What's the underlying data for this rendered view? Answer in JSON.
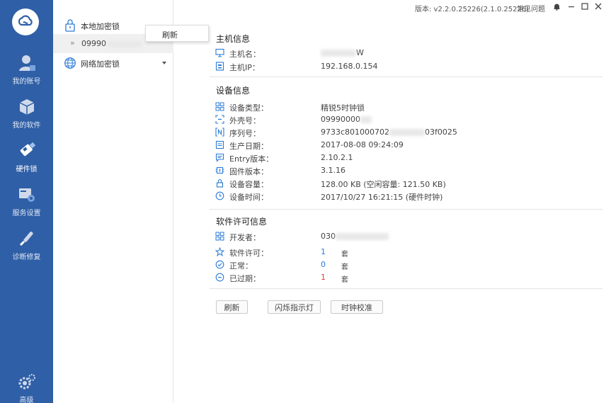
{
  "nav": {
    "items": [
      {
        "label": "我的账号",
        "icon": "user-icon"
      },
      {
        "label": "我的软件",
        "icon": "cube-icon"
      },
      {
        "label": "硬件锁",
        "icon": "usb-key-icon"
      },
      {
        "label": "服务设置",
        "icon": "settings-panel-icon"
      },
      {
        "label": "诊断修复",
        "icon": "repair-icon"
      },
      {
        "label": "高级",
        "icon": "gears-icon"
      }
    ],
    "active_index": 2
  },
  "tree": {
    "local_label": "本地加密锁",
    "local_child": "09990",
    "network_label": "网络加密锁"
  },
  "context_menu": {
    "refresh": "刷新"
  },
  "titlebar": {
    "version": "版本: v2.2.0.25226(2.1.0.25226)",
    "faq": "常见问题"
  },
  "host": {
    "title": "主机信息",
    "name_label": "主机名：",
    "name_value_suffix": "W",
    "ip_label": "主机IP：",
    "ip_value": "192.168.0.154"
  },
  "device": {
    "title": "设备信息",
    "rows": [
      {
        "label": "设备类型：",
        "value": "精锐5时钟锁",
        "icon": "grid-icon"
      },
      {
        "label": "外壳号：",
        "value": "09990000",
        "icon": "scan-icon"
      },
      {
        "label": "序列号：",
        "value": "9733c801000702",
        "value_suffix": "03f0025",
        "icon": "serial-icon"
      },
      {
        "label": "生产日期：",
        "value": "2017-08-08 09:24:09",
        "icon": "calendar-icon"
      },
      {
        "label": "Entry版本：",
        "value": "2.10.2.1",
        "icon": "chat-icon"
      },
      {
        "label": "固件版本：",
        "value": "3.1.16",
        "icon": "chip-icon"
      },
      {
        "label": "设备容量：",
        "value": "128.00 KB  (空闲容量: 121.50 KB)",
        "icon": "lock-icon"
      },
      {
        "label": "设备时间：",
        "value": "2017/10/27 16:21:15 (硬件时钟)",
        "icon": "clock-icon"
      }
    ]
  },
  "license": {
    "title": "软件许可信息",
    "developer_label": "开发者：",
    "developer_value": "030",
    "rows": [
      {
        "label": "软件许可：",
        "value": "1",
        "unit": "套",
        "color": "#2b7bd6",
        "icon": "star-icon"
      },
      {
        "label": "正常：",
        "value": "0",
        "unit": "套",
        "color": "#2b7bd6",
        "icon": "check-circle-icon"
      },
      {
        "label": "已过期：",
        "value": "1",
        "unit": "套",
        "color": "#e23b3b",
        "icon": "minus-circle-icon"
      }
    ]
  },
  "buttons": {
    "refresh": "刷新",
    "blink": "闪烁指示灯",
    "clock_sync": "时钟校准"
  },
  "colors": {
    "nav_bg": "#2f5fa6",
    "accent": "#2b7bd6",
    "danger": "#e23b3b"
  }
}
